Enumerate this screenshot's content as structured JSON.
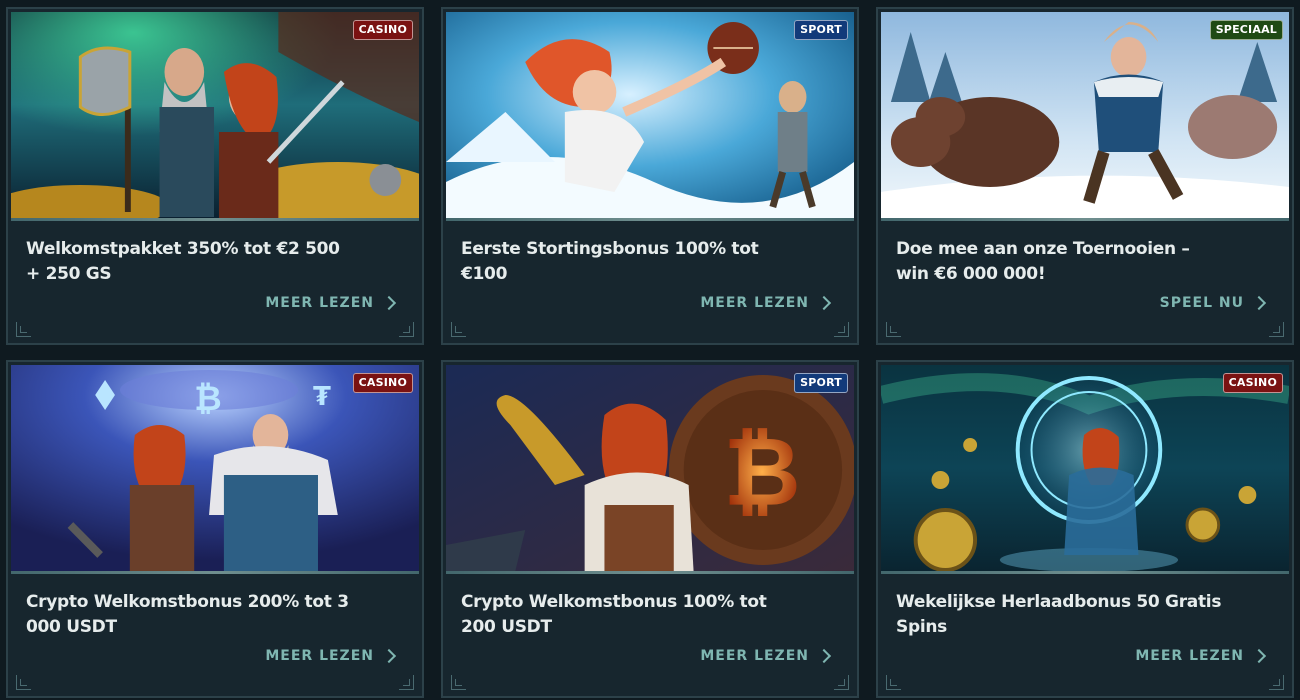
{
  "cards": [
    {
      "badge": "CASINO",
      "badge_type": "casino",
      "title": "Welkomstpakket 350% tot €2 500 + 250 GS",
      "cta": "MEER LEZEN",
      "art": "viking-duo-with-axe-and-gold"
    },
    {
      "badge": "SPORT",
      "badge_type": "sport",
      "title": "Eerste Stortingsbonus 100% tot €100",
      "cta": "MEER LEZEN",
      "art": "viking-girl-throwing-ball"
    },
    {
      "badge": "SPECIAAL",
      "badge_type": "speciaal",
      "title": "Doe mee aan onze Toernooien – win €6 000 000!",
      "cta": "SPEEL NU",
      "art": "viking-running-with-boars"
    },
    {
      "badge": "CASINO",
      "badge_type": "casino",
      "title": "Crypto Welkomstbonus 200% tot 3 000 USDT",
      "cta": "MEER LEZEN",
      "art": "vikings-with-crypto-coins"
    },
    {
      "badge": "SPORT",
      "badge_type": "sport",
      "title": "Crypto Welkomstbonus 100% tot 200 USDT",
      "cta": "MEER LEZEN",
      "art": "viking-horn-bitcoin-shield"
    },
    {
      "badge": "CASINO",
      "badge_type": "casino",
      "title": "Wekelijkse Herlaadbonus 50 Gratis Spins",
      "cta": "MEER LEZEN",
      "art": "viking-reload-portal"
    }
  ],
  "colors": {
    "background": "#0f1a20",
    "card": "#17262e",
    "cta": "#7fb6b1",
    "casino": "#7a1212",
    "sport": "#123a7a",
    "speciaal": "#1f4a14"
  }
}
